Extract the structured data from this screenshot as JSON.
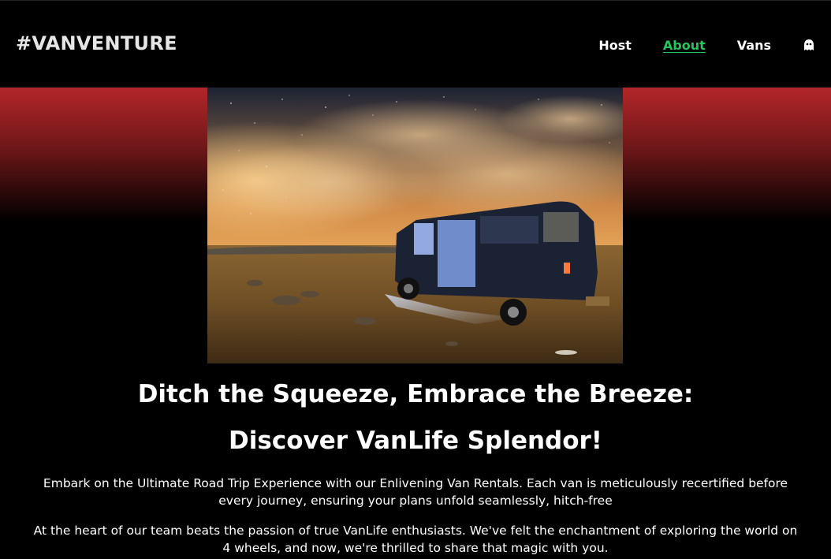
{
  "header": {
    "logo": "#VANVENTURE",
    "nav": [
      {
        "label": "Host",
        "active": false
      },
      {
        "label": "About",
        "active": true
      },
      {
        "label": "Vans",
        "active": false
      }
    ],
    "account_icon": "ghost-icon"
  },
  "colors": {
    "background": "#000000",
    "accent_active": "#22c55e",
    "hero_gradient_top": "#b3262a"
  },
  "main": {
    "heading_line1": "Ditch the Squeeze, Embrace the Breeze:",
    "heading_line2": "Discover VanLife Splendor!",
    "paragraph1": "Embark on the Ultimate Road Trip Experience with our Enlivening Van Rentals. Each van is meticulously recertified before every journey, ensuring your plans unfold seamlessly, hitch-free",
    "paragraph2": "At the heart of our team beats the passion of true VanLife enthusiasts. We've felt the enchantment of exploring the world on 4 wheels, and now, we're thrilled to share that magic with you."
  }
}
